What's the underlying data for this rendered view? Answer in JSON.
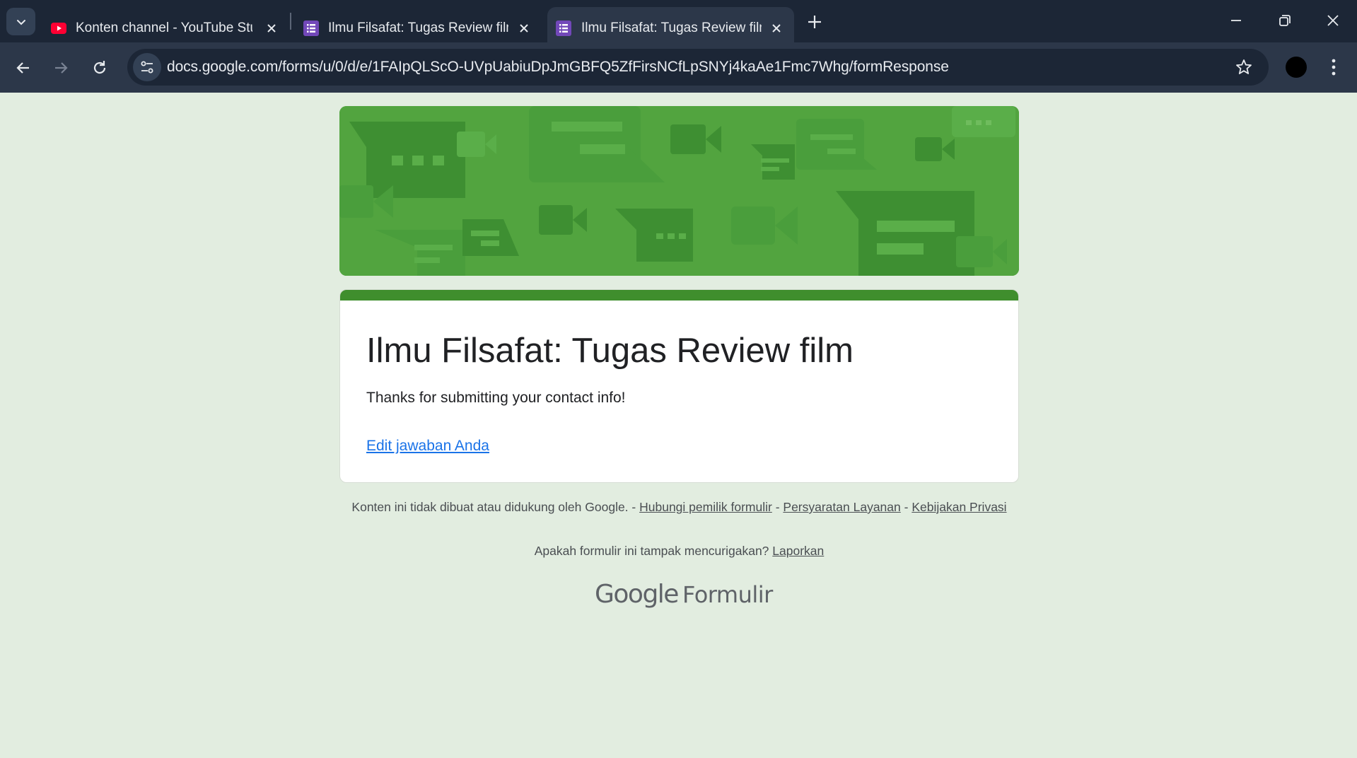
{
  "browser": {
    "tabs": [
      {
        "title": "Konten channel - YouTube Stud",
        "favicon": "youtube-icon",
        "active": false
      },
      {
        "title": "Ilmu Filsafat: Tugas Review film",
        "favicon": "google-forms-icon",
        "active": false
      },
      {
        "title": "Ilmu Filsafat: Tugas Review film",
        "favicon": "google-forms-icon",
        "active": true
      }
    ],
    "url": "docs.google.com/forms/u/0/d/e/1FAIpQLScO-UVpUabiuDpJmGBFQ5ZfFirsNCfLpSNYj4kaAe1Fmc7Whg/formResponse"
  },
  "form": {
    "title": "Ilmu Filsafat: Tugas Review film",
    "confirmation": "Thanks for submitting your contact info!",
    "edit_link": "Edit jawaban Anda",
    "accent_color": "#3f8e2d",
    "banner_color": "#52a43f"
  },
  "footer": {
    "disclaimer": "Konten ini tidak dibuat atau didukung oleh Google. - ",
    "contact_owner": "Hubungi pemilik formulir",
    "sep1": " - ",
    "terms": "Persyaratan Layanan",
    "sep2": " - ",
    "privacy": "Kebijakan Privasi",
    "suspicious": "Apakah formulir ini tampak mencurigakan? ",
    "report": "Laporkan",
    "brand_google": "Google",
    "brand_product": "Formulir"
  }
}
